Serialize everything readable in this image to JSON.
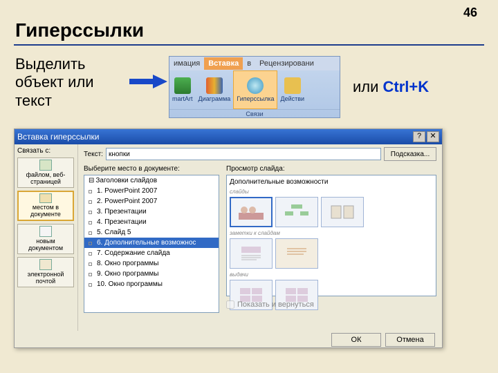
{
  "page_number": "46",
  "slide_title": "Гиперссылки",
  "instruction": "Выделить\nобъект или\nтекст",
  "or_text": "или ",
  "shortcut": "Ctrl+K",
  "ribbon": {
    "tabs": [
      "имация",
      "Вставка",
      "в",
      "Рецензировани"
    ],
    "buttons": [
      {
        "label": "martArt",
        "color": "linear-gradient(#4caf50,#2d7b30)"
      },
      {
        "label": "Диаграмма",
        "color": "linear-gradient(#e06030,#3a65b0)"
      },
      {
        "label": "Гиперссылка",
        "color": "radial-gradient(#8fd4e8,#3a95c0)"
      },
      {
        "label": "Действи",
        "color": "#e8c050"
      }
    ],
    "group": "Связи"
  },
  "dialog": {
    "title": "Вставка гиперссылки",
    "help_sym": "?",
    "close_sym": "✕",
    "link_to_label": "Связать с:",
    "sidebar": [
      "файлом, веб-страницей",
      "местом в документе",
      "новым документом",
      "электронной почтой"
    ],
    "text_label": "Текст:",
    "text_value": "кнопки",
    "hint_btn": "Подсказка...",
    "tree_label": "Выберите место в документе:",
    "tree_root": "Заголовки слайдов",
    "tree_items": [
      "1. PowerPoint 2007",
      "2. PowerPoint 2007",
      "3. Презентации",
      "4. Презентации",
      "5. Слайд 5",
      "6. Дополнительные возможнос",
      "7. Содержание слайда",
      "8. Окно программы",
      "9. Окно программы",
      "10. Окно программы"
    ],
    "tree_selected": 5,
    "preview_label": "Просмотр слайда:",
    "preview_title": "Дополнительные возможности",
    "preview_sub1": "слайды",
    "preview_sub2": "заметки к слайдам",
    "preview_sub3": "выдачи",
    "checkbox": "Показать и вернуться",
    "ok": "ОК",
    "cancel": "Отмена"
  }
}
